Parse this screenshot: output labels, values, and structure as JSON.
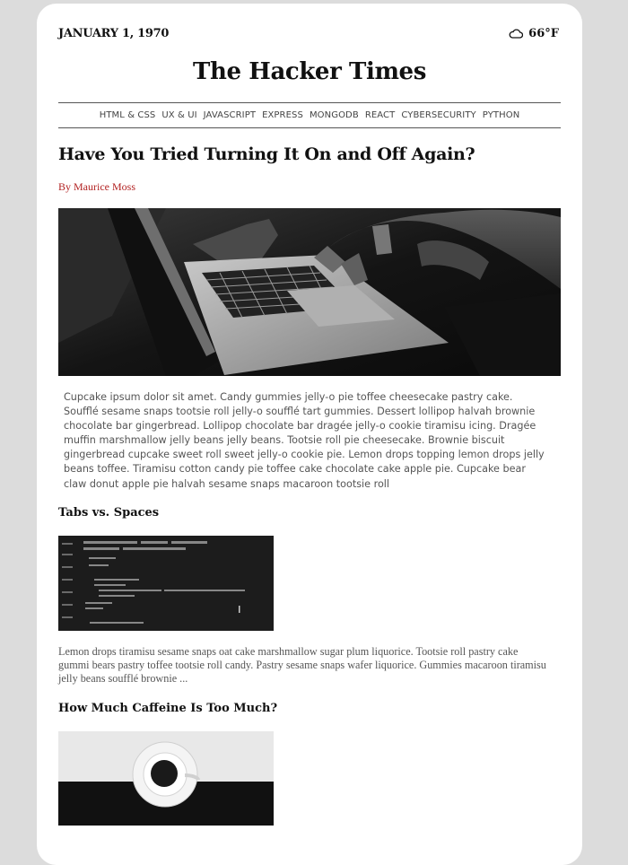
{
  "header": {
    "date": "JANUARY 1, 1970",
    "weather_icon": "cloud-icon",
    "temperature": "66°F"
  },
  "masthead": {
    "title": "The Hacker Times"
  },
  "nav": {
    "items": [
      "HTML & CSS",
      "UX & UI",
      "JAVASCRIPT",
      "EXPRESS",
      "MONGODB",
      "REACT",
      "CYBERSECURITY",
      "PYTHON"
    ]
  },
  "article": {
    "headline": "Have You Tried Turning It On and Off Again?",
    "byline": "By Maurice Moss",
    "hero_image": "laptop-typing-photo",
    "body": "Cupcake ipsum dolor sit amet. Candy gummies jelly-o pie toffee cheesecake pastry cake. Soufflé sesame snaps tootsie roll jelly-o soufflé tart gummies. Dessert lollipop halvah brownie chocolate bar gingerbread. Lollipop chocolate bar dragée jelly-o cookie tiramisu icing. Dragée muffin marshmallow jelly beans jelly beans. Tootsie roll pie cheesecake. Brownie biscuit gingerbread cupcake sweet roll sweet jelly-o cookie pie. Lemon drops topping lemon drops jelly beans toffee. Tiramisu cotton candy pie toffee cake chocolate cake apple pie. Cupcake bear claw donut apple pie halvah sesame snaps macaroon tootsie roll"
  },
  "stories": [
    {
      "title": "Tabs vs. Spaces",
      "image": "code-screen-photo",
      "summary": "Lemon drops tiramisu sesame snaps oat cake marshmallow sugar plum liquorice. Tootsie roll pastry cake gummi bears pastry toffee tootsie roll candy. Pastry sesame snaps wafer liquorice. Gummies macaroon tiramisu jelly beans soufflé brownie ..."
    },
    {
      "title": "How Much Caffeine Is Too Much?",
      "image": "coffee-cup-photo"
    }
  ],
  "colors": {
    "page_bg": "#dcdcdc",
    "card_bg": "#ffffff",
    "byline": "#b22222",
    "text": "#111111",
    "muted": "#555555"
  }
}
